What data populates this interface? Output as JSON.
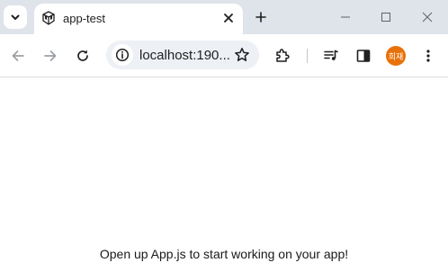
{
  "browser": {
    "tab": {
      "title": "app-test"
    },
    "address_bar": {
      "url": "localhost:190..."
    },
    "profile": {
      "initials": "희재",
      "color": "#e8710a"
    },
    "icons": {
      "tab_search": "chevron-down-icon",
      "close_tab": "close-icon",
      "new_tab": "plus-icon",
      "minimize": "minimize-icon",
      "maximize": "maximize-icon",
      "close_window": "close-window-icon",
      "back": "back-arrow-icon",
      "forward": "forward-arrow-icon",
      "reload": "reload-icon",
      "site_info": "info-icon",
      "bookmark": "star-icon",
      "extensions": "puzzle-icon",
      "media": "media-queue-icon",
      "side_panel": "side-panel-icon",
      "menu": "kebab-menu-icon"
    }
  },
  "page": {
    "message": "Open up App.js to start working on your app!"
  }
}
